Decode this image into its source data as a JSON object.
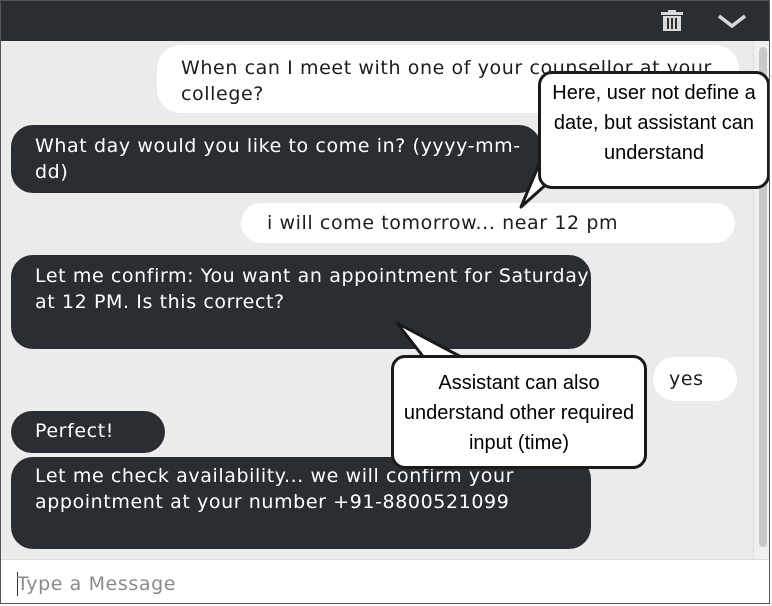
{
  "header": {
    "icons": [
      "trash-icon",
      "chevron-down-icon"
    ],
    "bg_color": "#2a2d31"
  },
  "messages": [
    {
      "role": "user",
      "text": "When can I meet with one of your counsellor at your college?"
    },
    {
      "role": "bot",
      "text": "What day would you like to come in? (yyyy-mm-dd)"
    },
    {
      "role": "user",
      "text": "i will come tomorrow... near 12 pm"
    },
    {
      "role": "bot",
      "text": "Let me confirm: You want an appointment for Saturday at 12 PM. Is this correct?"
    },
    {
      "role": "user",
      "text": "yes"
    },
    {
      "role": "bot",
      "text": "Perfect!"
    },
    {
      "role": "bot",
      "text": "Let me check availability... we will confirm your appointment at your number +91-8800521099"
    }
  ],
  "callouts": [
    {
      "text": "Here, user not define a date, but assistant can understand"
    },
    {
      "text": "Assistant can also understand other required input (time)"
    }
  ],
  "composer": {
    "placeholder": "Type a Message"
  },
  "colors": {
    "bot_bubble": "#2a2d31",
    "user_bubble": "#ffffff",
    "chat_bg": "#ebebeb"
  }
}
